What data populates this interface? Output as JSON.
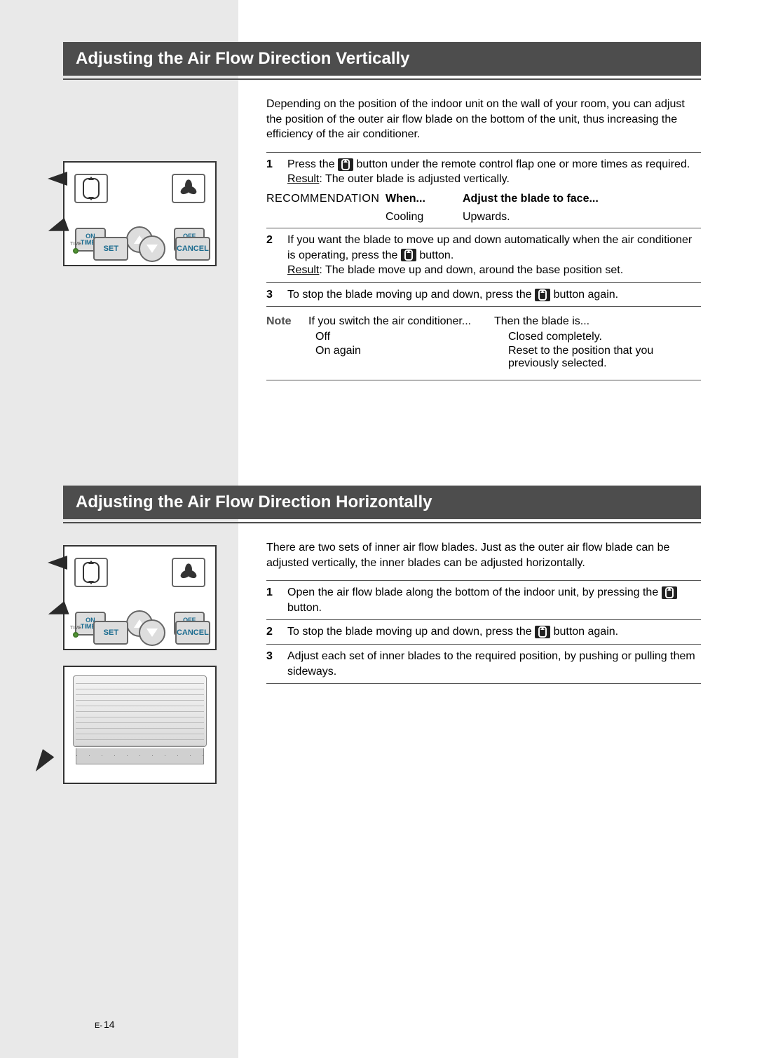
{
  "section1": {
    "heading": "Adjusting the Air Flow Direction Vertically",
    "intro": "Depending on the position of the indoor unit on the wall of your room, you can adjust the position of the outer air flow blade on the bottom of the unit, thus increasing the efficiency of the air conditioner.",
    "step1_a": "Press the ",
    "step1_b": " button under the remote control flap one or more times as required.",
    "step1_result_label": "Result",
    "step1_result": ":   The outer blade is adjusted vertically.",
    "rec_label": "RECOMMENDATION",
    "rec_when_h": "When...",
    "rec_adj_h": "Adjust the blade to face...",
    "rec_when_v": "Cooling",
    "rec_adj_v": "Upwards.",
    "step2_a": "If you want the blade to move up and down automatically when the air conditioner is operating, press the ",
    "step2_b": " button.",
    "step2_result_label": "Result",
    "step2_result": ":   The blade move up and down, around the base position set.",
    "step3_a": "To stop the blade moving up and down, press the ",
    "step3_b": " button again.",
    "note_label": "Note",
    "note_head1": "If you switch the air conditioner...",
    "note_head2": "Then the blade is...",
    "note_r1c1": "Off",
    "note_r1c2": "Closed completely.",
    "note_r2c1": "On again",
    "note_r2c2": "Reset to the position that you previously selected."
  },
  "section2": {
    "heading": "Adjusting the Air Flow Direction Horizontally",
    "intro": "There are two sets of inner air flow blades. Just as the outer air flow blade can be adjusted vertically, the inner blades can be adjusted horizontally.",
    "step1_a": "Open the air flow blade along the bottom of the indoor unit, by pressing the ",
    "step1_b": " button.",
    "step2_a": "To stop the blade moving up and down, press the ",
    "step2_b": " button again.",
    "step3": "Adjust each set of inner blades to the required position, by pushing or pulling them sideways."
  },
  "remote": {
    "on_timer": "ON",
    "on_timer2": "TIMER",
    "off_timer": "OFF",
    "off_timer2": "TIMER",
    "set": "SET",
    "cancel": "CANCEL",
    "time": "TIME"
  },
  "page_number_prefix": "E-",
  "page_number": "14"
}
